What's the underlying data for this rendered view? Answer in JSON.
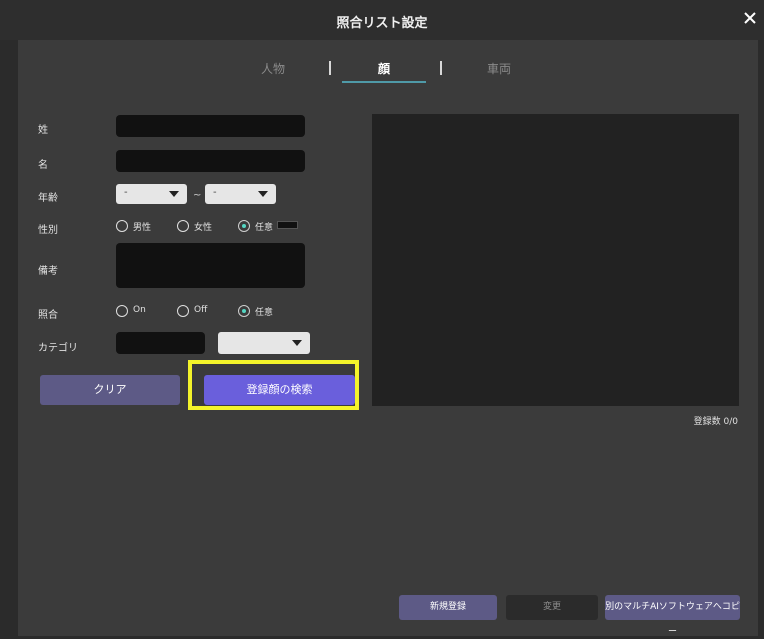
{
  "window": {
    "title": "照合リスト設定"
  },
  "tabs": [
    {
      "label": "人物",
      "active": false
    },
    {
      "label": "顔",
      "active": true
    },
    {
      "label": "車両",
      "active": false
    }
  ],
  "form": {
    "last_name_label": "姓",
    "first_name_label": "名",
    "age_label": "年齢",
    "age_from": "-",
    "age_to": "-",
    "age_separator": "~",
    "gender_label": "性別",
    "gender_options": [
      "男性",
      "女性",
      "任意"
    ],
    "gender_selected": "任意",
    "note_label": "備考",
    "match_label": "照合",
    "match_options": [
      "On",
      "Off",
      "任意"
    ],
    "match_selected": "任意",
    "category_label": "カテゴリ",
    "category_value": ""
  },
  "buttons": {
    "clear": "クリア",
    "search_registered_faces": "登録顔の検索",
    "new_register": "新規登録",
    "change": "変更",
    "copy_to_other": "別のマルチAIソフトウェアへコピー"
  },
  "registered_count": "登録数 0/0",
  "colors": {
    "accent": "#6a5fdc",
    "button": "#5d5a86",
    "highlight": "#f4f42a",
    "radio_selected": "#55d6c3",
    "tab_underline": "#4f9aa8"
  }
}
